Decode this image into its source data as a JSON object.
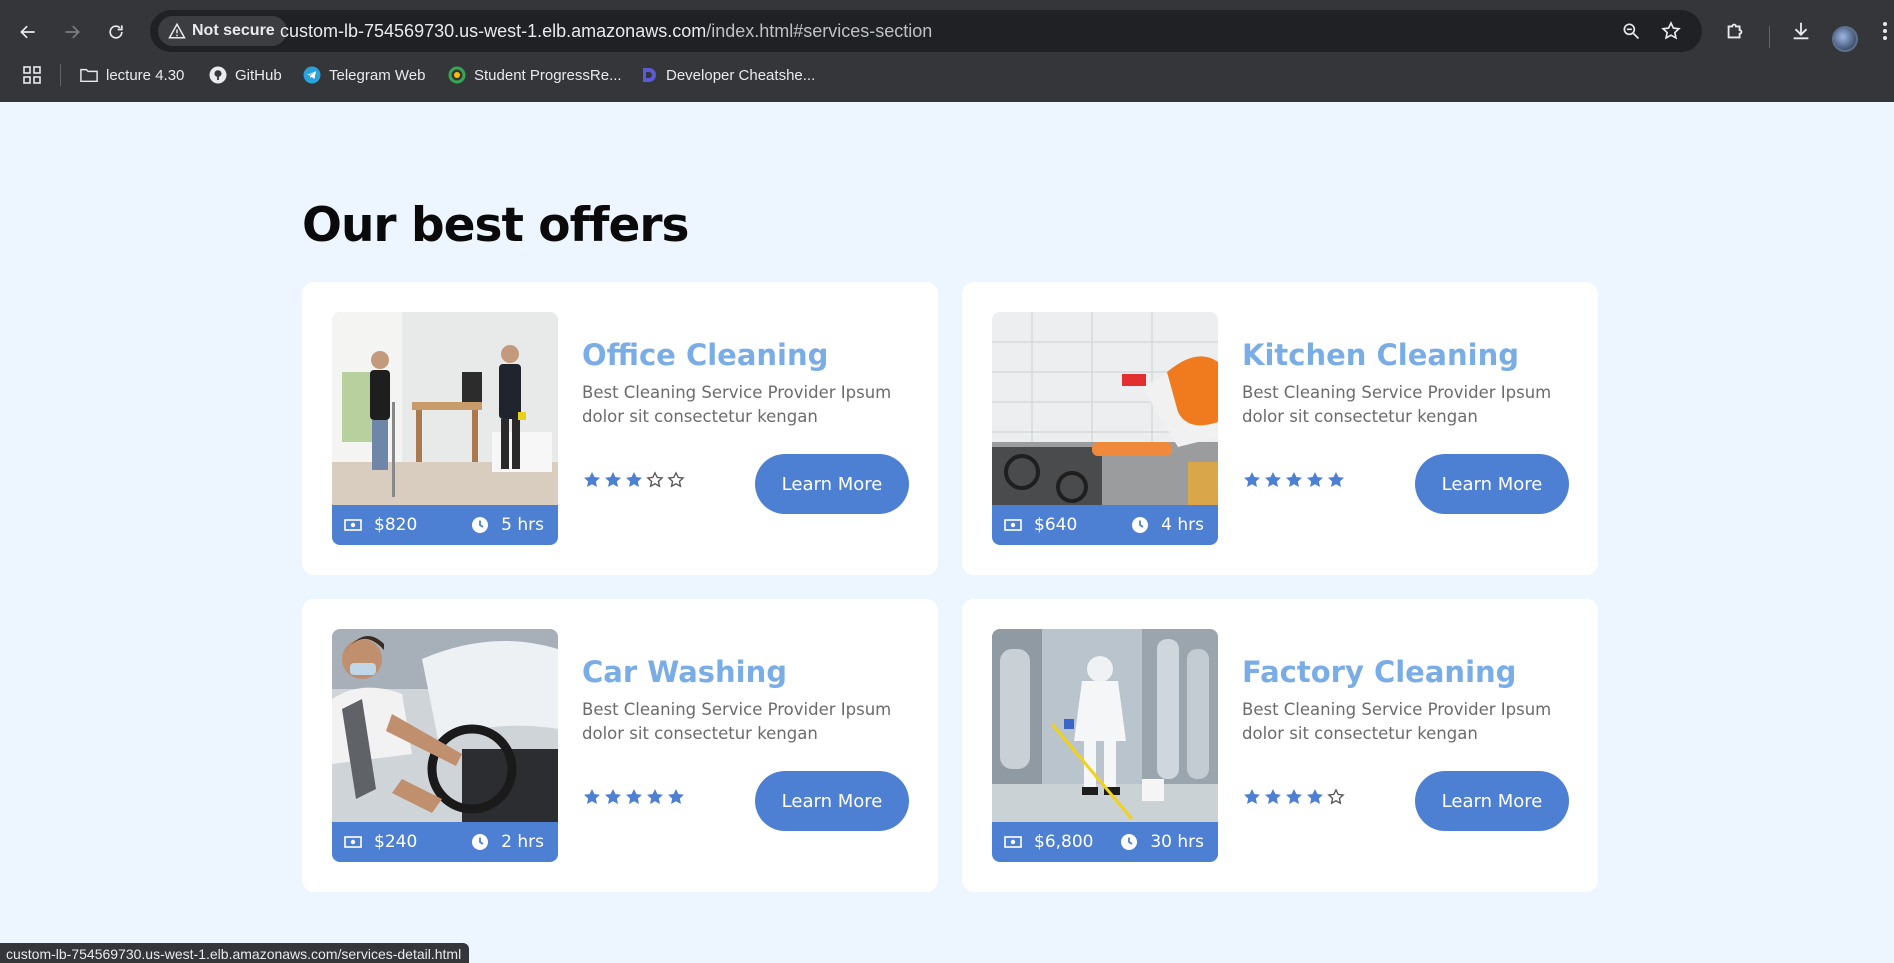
{
  "browser": {
    "security_label": "Not secure",
    "url_host": "custom-lb-754569730.us-west-1.elb.amazonaws.com",
    "url_path": "/index.html#services-section",
    "status_url": "custom-lb-754569730.us-west-1.elb.amazonaws.com/services-detail.html",
    "bookmarks": [
      {
        "label": "lecture 4.30",
        "icon": "folder-icon"
      },
      {
        "label": "GitHub",
        "icon": "github-icon"
      },
      {
        "label": "Telegram Web",
        "icon": "telegram-icon"
      },
      {
        "label": "Student ProgressRe...",
        "icon": "progress-report-icon"
      },
      {
        "label": "Developer Cheatshe...",
        "icon": "cheatsheet-icon"
      }
    ]
  },
  "section": {
    "title": "Our best offers"
  },
  "colors": {
    "accent": "#4d7fd3",
    "title": "#7aade6",
    "page_bg": "#edf6ff",
    "chrome": "#35363a"
  },
  "offers": [
    {
      "title": "Office Cleaning",
      "description": "Best Cleaning Service Provider Ipsum dolor sit consectetur kengan",
      "price": "$820",
      "duration": "5 hrs",
      "rating": 3,
      "rating_max": 5,
      "button": "Learn More"
    },
    {
      "title": "Kitchen Cleaning",
      "description": "Best Cleaning Service Provider Ipsum dolor sit consectetur kengan",
      "price": "$640",
      "duration": "4 hrs",
      "rating": 5,
      "rating_max": 5,
      "button": "Learn More"
    },
    {
      "title": "Car Washing",
      "description": "Best Cleaning Service Provider Ipsum dolor sit consectetur kengan",
      "price": "$240",
      "duration": "2 hrs",
      "rating": 5,
      "rating_max": 5,
      "button": "Learn More"
    },
    {
      "title": "Factory Cleaning",
      "description": "Best Cleaning Service Provider Ipsum dolor sit consectetur kengan",
      "price": "$6,800",
      "duration": "30 hrs",
      "rating": 4,
      "rating_max": 5,
      "button": "Learn More"
    }
  ]
}
